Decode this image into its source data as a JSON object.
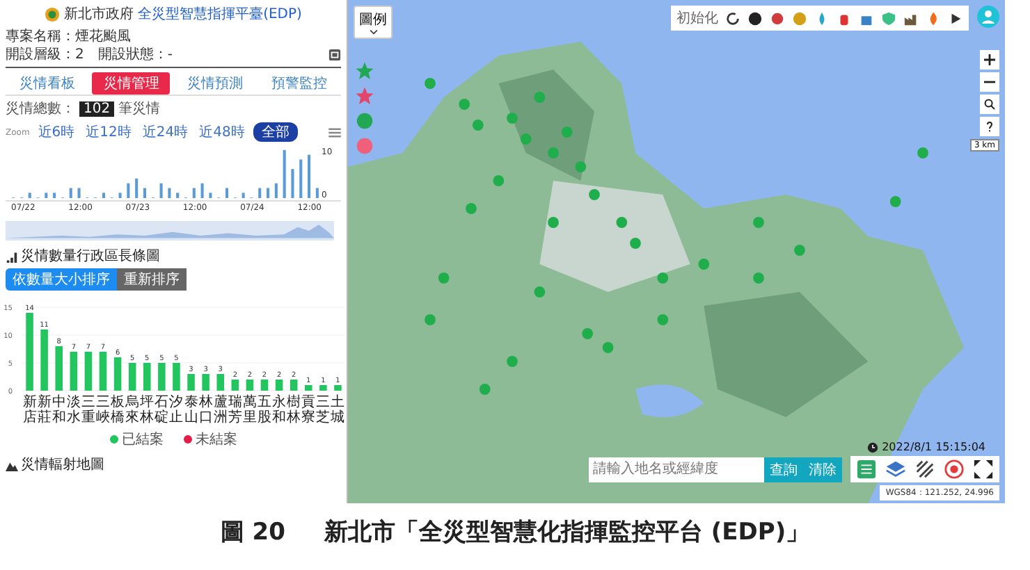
{
  "header": {
    "logo_text": "新北市政府",
    "title": "全災型智慧指揮平臺(EDP)"
  },
  "project": {
    "name_label": "專案名稱：煙花颱風",
    "level_label": "開設層級：2",
    "status_label": "開設狀態：-"
  },
  "tabs": [
    {
      "label": "災情看板",
      "selected": false
    },
    {
      "label": "災情管理",
      "selected": true
    },
    {
      "label": "災情預測",
      "selected": false
    },
    {
      "label": "預警監控",
      "selected": false
    }
  ],
  "total": {
    "label": "災情總數：",
    "count": "102",
    "unit": "筆災情"
  },
  "zoom": {
    "label": "Zoom",
    "options": [
      {
        "label": "近6時",
        "selected": false
      },
      {
        "label": "近12時",
        "selected": false
      },
      {
        "label": "近24時",
        "selected": false
      },
      {
        "label": "近48時",
        "selected": false
      },
      {
        "label": "全部",
        "selected": true
      }
    ]
  },
  "timeline": {
    "x_labels": [
      "07/22",
      "12:00",
      "07/23",
      "12:00",
      "07/24",
      "12:00"
    ],
    "y_labels": [
      "10",
      "0"
    ]
  },
  "district_section": {
    "title": "災情數量行政區長條圖",
    "buttons": [
      {
        "label": "依數量大小排序",
        "selected": true
      },
      {
        "label": "重新排序",
        "selected": false
      }
    ],
    "chart_data": {
      "type": "bar",
      "categories": [
        "新店",
        "新莊",
        "中和",
        "淡水",
        "三重",
        "三峽",
        "板橋",
        "烏來",
        "坪林",
        "石碇",
        "汐止",
        "泰山",
        "林口",
        "蘆洲",
        "瑞芳",
        "萬里",
        "五股",
        "永和",
        "樹林",
        "貢寮",
        "三芝",
        "土城"
      ],
      "series": [
        {
          "name": "已結案",
          "color": "#22c55e",
          "values": [
            14,
            11,
            8,
            7,
            7,
            7,
            6,
            5,
            5,
            5,
            5,
            3,
            3,
            3,
            2,
            2,
            2,
            2,
            2,
            1,
            1,
            1
          ]
        }
      ],
      "ylim": [
        0,
        15
      ],
      "yticks": [
        0,
        5,
        10,
        15
      ],
      "data_labels": true
    },
    "legend_extra": [
      {
        "label": "未結案",
        "color": "#e11d48"
      }
    ]
  },
  "bottom_section": {
    "title": "災情輻射地圖"
  },
  "map": {
    "legend_button": "圖例",
    "toolbar_label": "初始化",
    "scale": "3 km",
    "time": "2022/8/1 15:15:04",
    "search": {
      "placeholder": "請輸入地名或經緯度"
    },
    "search_buttons": [
      "查詢",
      "清除"
    ],
    "coordinates": "WGS84：121.252, 24.996"
  },
  "caption": {
    "number": "圖 20",
    "text": "新北市「全災型智慧化指揮監控平台 (EDP)」"
  }
}
